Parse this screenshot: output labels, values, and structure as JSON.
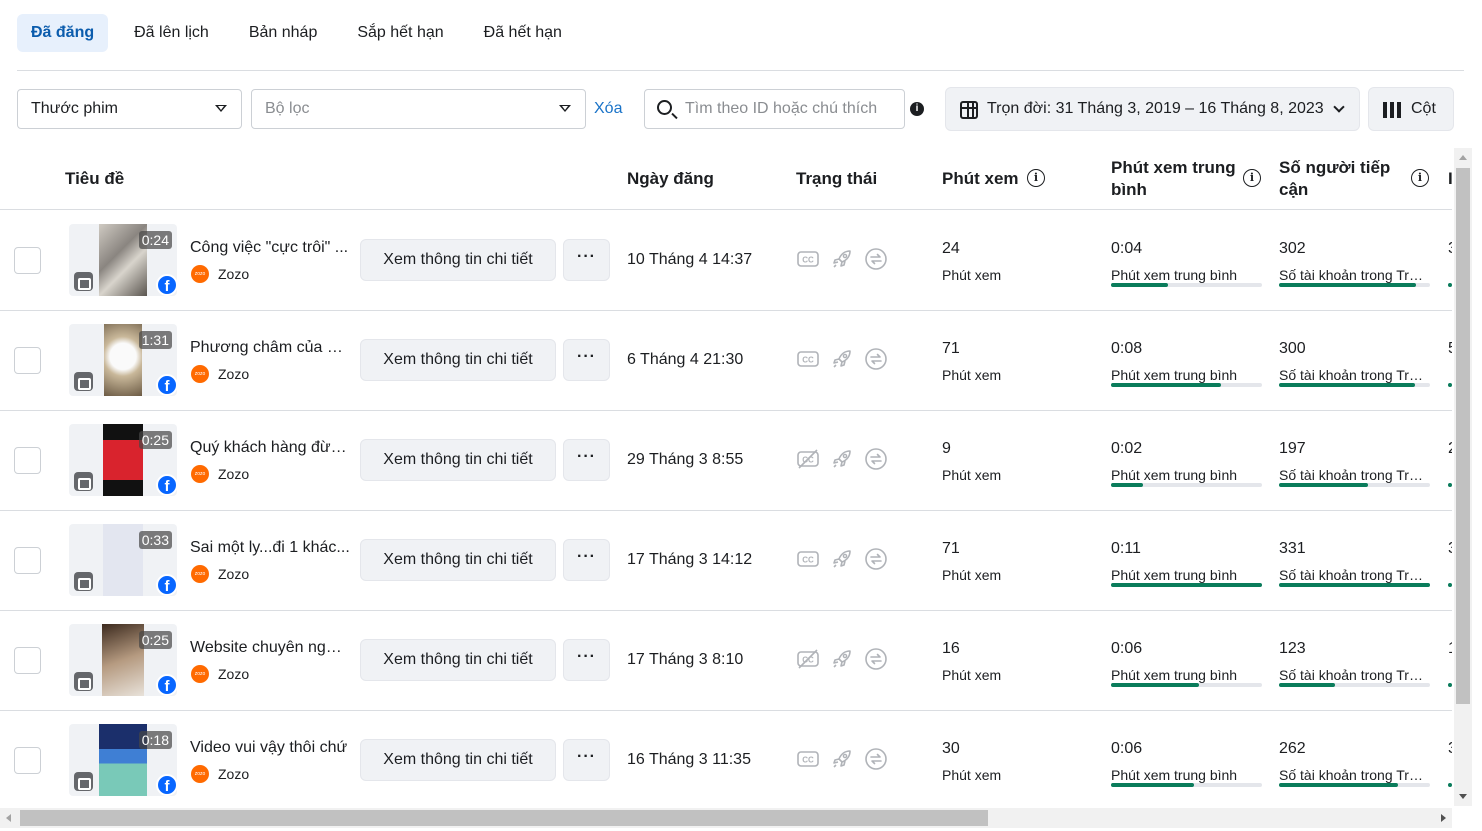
{
  "tabs": [
    {
      "label": "Đã đăng",
      "active": true
    },
    {
      "label": "Đã lên lịch",
      "active": false
    },
    {
      "label": "Bản nháp",
      "active": false
    },
    {
      "label": "Sắp hết hạn",
      "active": false
    },
    {
      "label": "Đã hết hạn",
      "active": false
    }
  ],
  "filters": {
    "type_select": "Thước phim",
    "filter_select_placeholder": "Bộ lọc",
    "clear_label": "Xóa",
    "search_placeholder": "Tìm theo ID hoặc chú thích",
    "info_glyph": "i",
    "date_range": "Trọn đời: 31 Tháng 3, 2019 – 16 Tháng 8, 2023",
    "columns_label": "Cột"
  },
  "table": {
    "headers": {
      "title": "Tiêu đề",
      "date": "Ngày đăng",
      "status": "Trạng thái",
      "minutes": "Phút xem",
      "avg_minutes": "Phút xem trung bình",
      "reach": "Số người tiếp cận",
      "next_partial": "I"
    },
    "info_glyph": "i",
    "detail_button": "Xem thông tin chi tiết",
    "more_button": "···",
    "page_name": "Zozo",
    "page_avatar_text": "zozo",
    "fb_glyph": "f",
    "minutes_label": "Phút xem",
    "avg_label": "Phút xem trung bình",
    "reach_label": "Số tài khoản trong Trung bình",
    "accent_color": "#0a7c5b",
    "rows": [
      {
        "title": "Công việc \"cực trôi\" ...",
        "duration": "0:24",
        "date": "10 Tháng 4 14:37",
        "minutes": "24",
        "avg": "0:04",
        "avg_fill": 0.38,
        "reach": "302",
        "reach_fill": 0.91,
        "next": "3",
        "captions": true
      },
      {
        "title": "Phương châm của Zozo",
        "duration": "1:31",
        "date": "6 Tháng 4 21:30",
        "minutes": "71",
        "avg": "0:08",
        "avg_fill": 0.73,
        "reach": "300",
        "reach_fill": 0.9,
        "next": "5",
        "captions": true
      },
      {
        "title": "Quý khách hàng đừng...",
        "duration": "0:25",
        "date": "29 Tháng 3 8:55",
        "minutes": "9",
        "avg": "0:02",
        "avg_fill": 0.21,
        "reach": "197",
        "reach_fill": 0.59,
        "next": "2",
        "captions": false
      },
      {
        "title": "Sai một ly...đi 1 khác...",
        "duration": "0:33",
        "date": "17 Tháng 3 14:12",
        "minutes": "71",
        "avg": "0:11",
        "avg_fill": 1.0,
        "reach": "331",
        "reach_fill": 1.0,
        "next": "3",
        "captions": true
      },
      {
        "title": "Website chuyên nghiệp",
        "duration": "0:25",
        "date": "17 Tháng 3 8:10",
        "minutes": "16",
        "avg": "0:06",
        "avg_fill": 0.58,
        "reach": "123",
        "reach_fill": 0.37,
        "next": "1",
        "captions": false
      },
      {
        "title": "Video vui vậy thôi chứ",
        "duration": "0:18",
        "date": "16 Tháng 3 11:35",
        "minutes": "30",
        "avg": "0:06",
        "avg_fill": 0.55,
        "reach": "262",
        "reach_fill": 0.79,
        "next": "3",
        "captions": true
      }
    ]
  }
}
